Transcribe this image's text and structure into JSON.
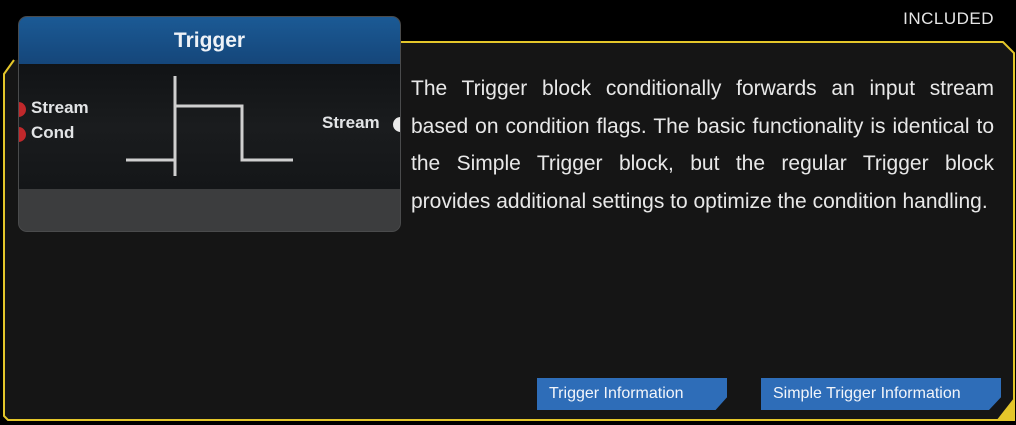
{
  "badge": "INCLUDED",
  "node": {
    "title": "Trigger",
    "inputs": [
      {
        "label": "Stream"
      },
      {
        "label": "Cond"
      }
    ],
    "output": {
      "label": "Stream"
    }
  },
  "description": "The Trigger block conditionally forwards an input stream based on condition flags. The basic functionality is identical to the Simple Trigger block, but the regular Trigger block provides additional settings to optimize the condition handling.",
  "buttons": {
    "trigger_info": "Trigger Information",
    "simple_trigger_info": "Simple Trigger Information"
  },
  "colors": {
    "frame_accent": "#e4c62a",
    "header_blue": "#1b5a95",
    "button_blue": "#2e6db8",
    "port_red": "#c0282b"
  },
  "icons": {
    "signal": "pulse-waveform-icon"
  }
}
